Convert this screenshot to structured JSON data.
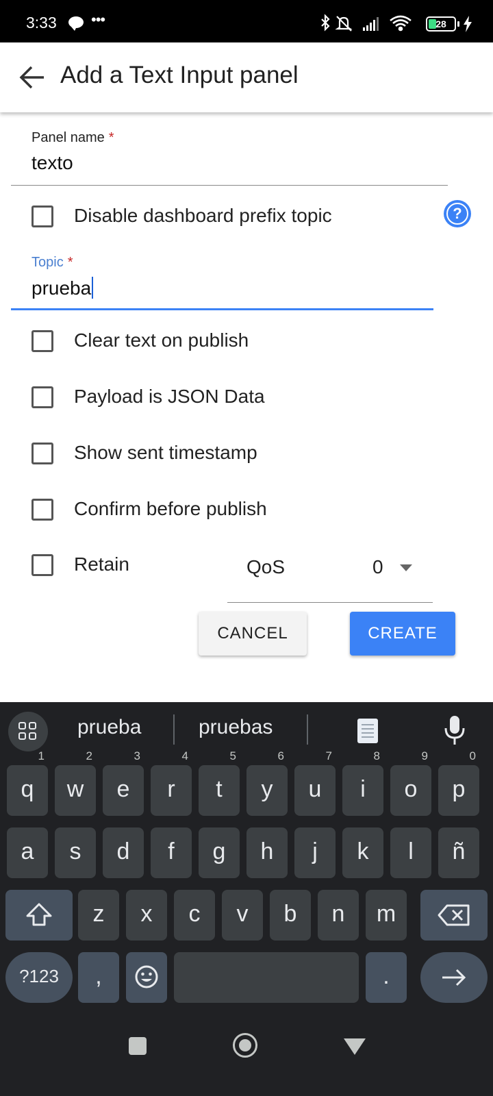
{
  "status_bar": {
    "time": "3:33",
    "battery": "28",
    "icons": [
      "chat-bubble-icon",
      "more-dots-icon",
      "bluetooth-icon",
      "mute-icon",
      "signal-icon",
      "wifi-icon",
      "battery-icon",
      "charging-icon"
    ]
  },
  "header": {
    "title": "Add a Text Input panel"
  },
  "form": {
    "panel_name_label": "Panel name",
    "panel_name_value": "texto",
    "required_mark": "*",
    "disable_prefix_label": "Disable dashboard prefix topic",
    "topic_label": "Topic",
    "topic_value": "prueba",
    "clear_text_label": "Clear text on publish",
    "payload_json_label": "Payload is JSON Data",
    "show_timestamp_label": "Show sent timestamp",
    "confirm_label": "Confirm before publish",
    "retain_label": "Retain",
    "qos_label": "QoS",
    "qos_value": "0"
  },
  "actions": {
    "cancel_label": "CANCEL",
    "create_label": "CREATE"
  },
  "keyboard": {
    "suggestions": [
      "prueba",
      "pruebas"
    ],
    "row1": [
      {
        "k": "q",
        "n": "1"
      },
      {
        "k": "w",
        "n": "2"
      },
      {
        "k": "e",
        "n": "3"
      },
      {
        "k": "r",
        "n": "4"
      },
      {
        "k": "t",
        "n": "5"
      },
      {
        "k": "y",
        "n": "6"
      },
      {
        "k": "u",
        "n": "7"
      },
      {
        "k": "i",
        "n": "8"
      },
      {
        "k": "o",
        "n": "9"
      },
      {
        "k": "p",
        "n": "0"
      }
    ],
    "row2": [
      "a",
      "s",
      "d",
      "f",
      "g",
      "h",
      "j",
      "k",
      "l",
      "ñ"
    ],
    "row3": [
      "z",
      "x",
      "c",
      "v",
      "b",
      "n",
      "m"
    ],
    "symbols_label": "?123",
    "comma": ",",
    "period": "."
  },
  "colors": {
    "accent": "#3b82f6",
    "focus_label": "#4a7fd0",
    "required": "#c62828",
    "keyboard_bg": "#202124",
    "key_bg": "#3c4043"
  }
}
